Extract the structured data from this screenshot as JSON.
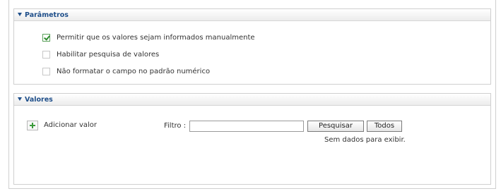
{
  "parametros": {
    "title": "Parâmetros",
    "options": [
      {
        "label": "Permitir que os valores sejam informados manualmente",
        "checked": true
      },
      {
        "label": "Habilitar pesquisa de valores",
        "checked": false
      },
      {
        "label": "Não formatar o campo no padrão numérico",
        "checked": false
      }
    ]
  },
  "valores": {
    "title": "Valores",
    "add_label": "Adicionar valor",
    "filter_label": "Filtro :",
    "filter_value": "",
    "search_button": "Pesquisar",
    "all_button": "Todos",
    "empty_message": "Sem dados para exibir."
  }
}
